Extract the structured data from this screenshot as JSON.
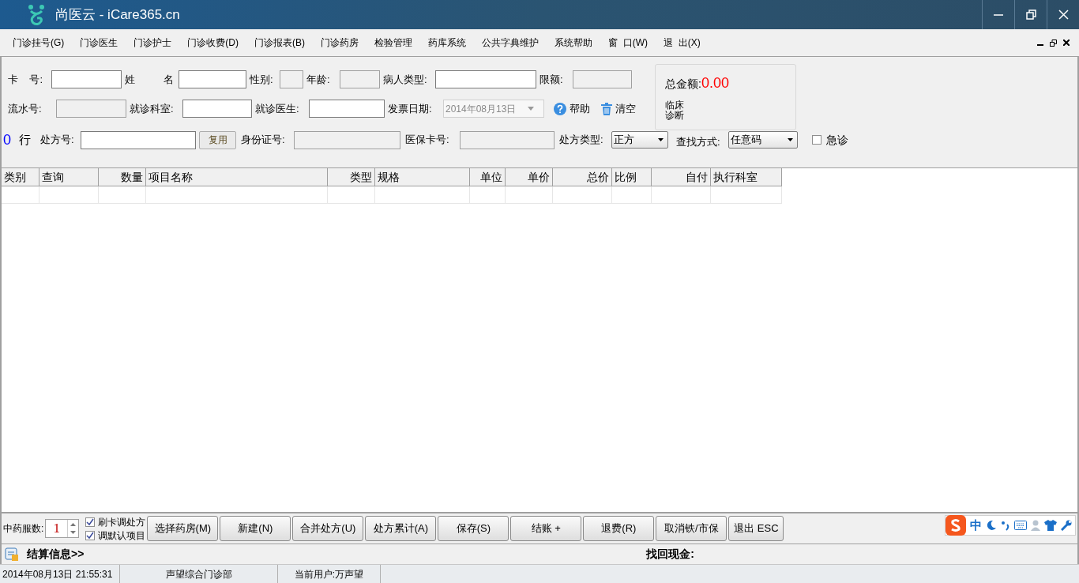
{
  "window": {
    "title": "尚医云 - iCare365.cn"
  },
  "menu": [
    "门诊挂号(G)",
    "门诊医生",
    "门诊护士",
    "门诊收费(D)",
    "门诊报表(B)",
    "门诊药房",
    "检验管理",
    "药库系统",
    "公共字典维护",
    "系统帮助",
    "窗  口(W)",
    "退  出(X)"
  ],
  "form": {
    "row1": [
      {
        "label": "卡    号:",
        "disabled": false
      },
      {
        "label": "姓          名",
        "disabled": false
      },
      {
        "label": "性别:",
        "disabled": true
      },
      {
        "label": "年龄:",
        "disabled": true
      },
      {
        "label": "病人类型:",
        "disabled": false
      },
      {
        "label": "限额:",
        "disabled": true
      }
    ],
    "row2": [
      {
        "label": "流水号:",
        "disabled": true
      },
      {
        "label": "就诊科室:",
        "disabled": false
      },
      {
        "label": "就诊医生:",
        "disabled": false
      }
    ],
    "invoice_date": {
      "label": "发票日期:",
      "value": "2014年08月13日",
      "disabled": true
    },
    "help": "帮助",
    "clear": "清空",
    "total": {
      "label": "总金额:",
      "value": "0.00"
    },
    "diagnosis": "临床诊断",
    "row_count": "0",
    "row_unit": "行",
    "prescription": {
      "label": "处方号:",
      "disabled": false
    },
    "reuse": "复用",
    "id_card": {
      "label": "身份证号:",
      "disabled": true
    },
    "insurance": {
      "label": "医保卡号:",
      "disabled": true
    },
    "selects": [
      {
        "label": "处方类型:",
        "value": "正方"
      },
      {
        "label": "查找方式:",
        "value": "任意码"
      }
    ],
    "urgent": {
      "label": "急诊",
      "checked": false
    }
  },
  "table": {
    "columns": [
      {
        "label": "类别",
        "numeric": false
      },
      {
        "label": "查询",
        "numeric": false
      },
      {
        "label": "数量",
        "numeric": true
      },
      {
        "label": "项目名称",
        "numeric": false
      },
      {
        "label": "类型",
        "numeric": true
      },
      {
        "label": "规格",
        "numeric": false
      },
      {
        "label": "单位",
        "numeric": true
      },
      {
        "label": "单价",
        "numeric": true
      },
      {
        "label": "总价",
        "numeric": true
      },
      {
        "label": "比例",
        "numeric": false
      },
      {
        "label": "自付",
        "numeric": true
      },
      {
        "label": "执行科室",
        "numeric": false
      }
    ]
  },
  "toolbar": {
    "doses_label": "中药服数:",
    "doses": "1",
    "checkboxes": [
      {
        "label": "刷卡调处方",
        "checked": true
      },
      {
        "label": "调默认项目",
        "checked": true
      }
    ],
    "buttons": [
      "选择药房(M)",
      "新建(N)",
      "合并处方(U)",
      "处方累计(A)",
      "保存(S)",
      "结账 +",
      "退费(R)",
      "取消铁/市保",
      "退出 ESC"
    ]
  },
  "ime": {
    "mode": "中"
  },
  "settlement": {
    "title": "结算信息>>",
    "change_label": "找回现金:"
  },
  "status_bar": [
    "2014年08月13日 21:55:31",
    "声望综合门诊部",
    "当前用户:万声望"
  ]
}
